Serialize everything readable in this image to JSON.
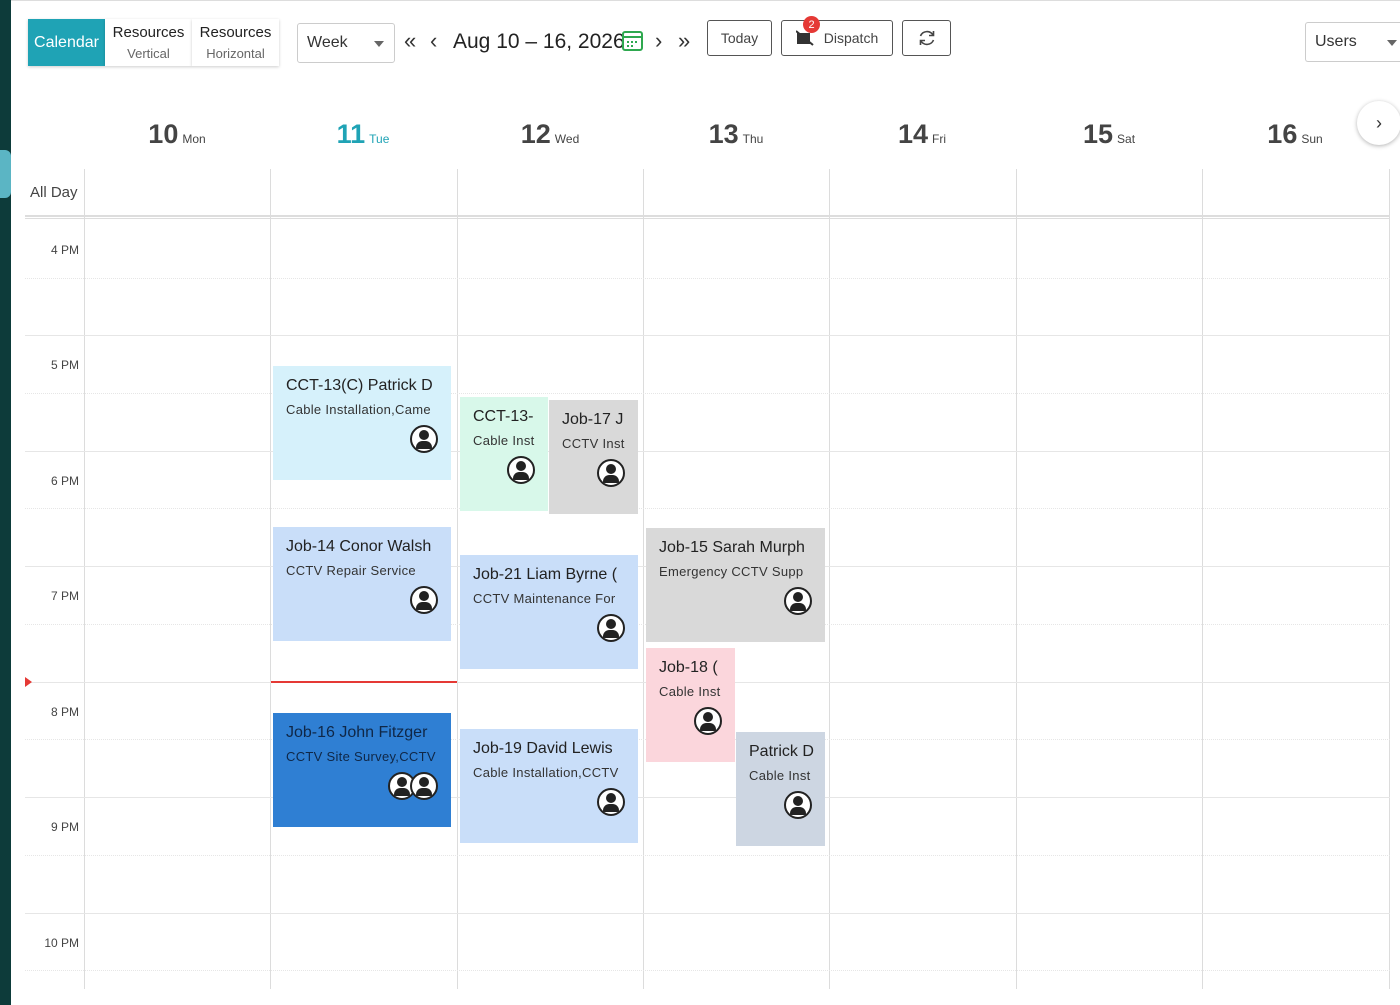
{
  "toolbar": {
    "views": [
      {
        "label": "Calendar",
        "sub": ""
      },
      {
        "label": "Resources",
        "sub": "Vertical"
      },
      {
        "label": "Resources",
        "sub": "Horizontal"
      }
    ],
    "view_select": "Week",
    "range_title": "Aug 10 – 16, 2026",
    "today_label": "Today",
    "dispatch_label": "Dispatch",
    "dispatch_badge": "2",
    "users_select": "Users"
  },
  "days": [
    {
      "num": "10",
      "dow": "Mon"
    },
    {
      "num": "11",
      "dow": "Tue"
    },
    {
      "num": "12",
      "dow": "Wed"
    },
    {
      "num": "13",
      "dow": "Thu"
    },
    {
      "num": "14",
      "dow": "Fri"
    },
    {
      "num": "15",
      "dow": "Sat"
    },
    {
      "num": "16",
      "dow": "Sun"
    }
  ],
  "today_index": 1,
  "all_day_label": "All Day",
  "times": [
    "4 PM",
    "5 PM",
    "6 PM",
    "7 PM",
    "8 PM",
    "9 PM",
    "10 PM"
  ],
  "events": [
    {
      "title": "CCT-13(C) Patrick D",
      "desc": "Cable Installation,Came",
      "color": "#d6f1fb"
    },
    {
      "title": "CCT-13-",
      "desc": "Cable Inst",
      "color": "#d8f8ea"
    },
    {
      "title": "Job-17 J",
      "desc": "CCTV Inst",
      "color": "#d9d9d9"
    },
    {
      "title": "Job-14 Conor Walsh",
      "desc": "CCTV Repair Service",
      "color": "#c9def9"
    },
    {
      "title": "Job-21 Liam Byrne (",
      "desc": "CCTV Maintenance For",
      "color": "#c9def9"
    },
    {
      "title": "Job-15 Sarah Murph",
      "desc": "Emergency CCTV Supp",
      "color": "#d9d9d9"
    },
    {
      "title": "Job-18 (",
      "desc": "Cable Inst",
      "color": "#fbd6dc"
    },
    {
      "title": "Job-16 John Fitzger",
      "desc": "CCTV Site Survey,CCTV",
      "color": "#2f7fd3"
    },
    {
      "title": "Job-19 David Lewis",
      "desc": "Cable Installation,CCTV",
      "color": "#c9def9"
    },
    {
      "title": "Patrick D",
      "desc": "Cable Inst",
      "color": "#cdd6e2"
    }
  ]
}
